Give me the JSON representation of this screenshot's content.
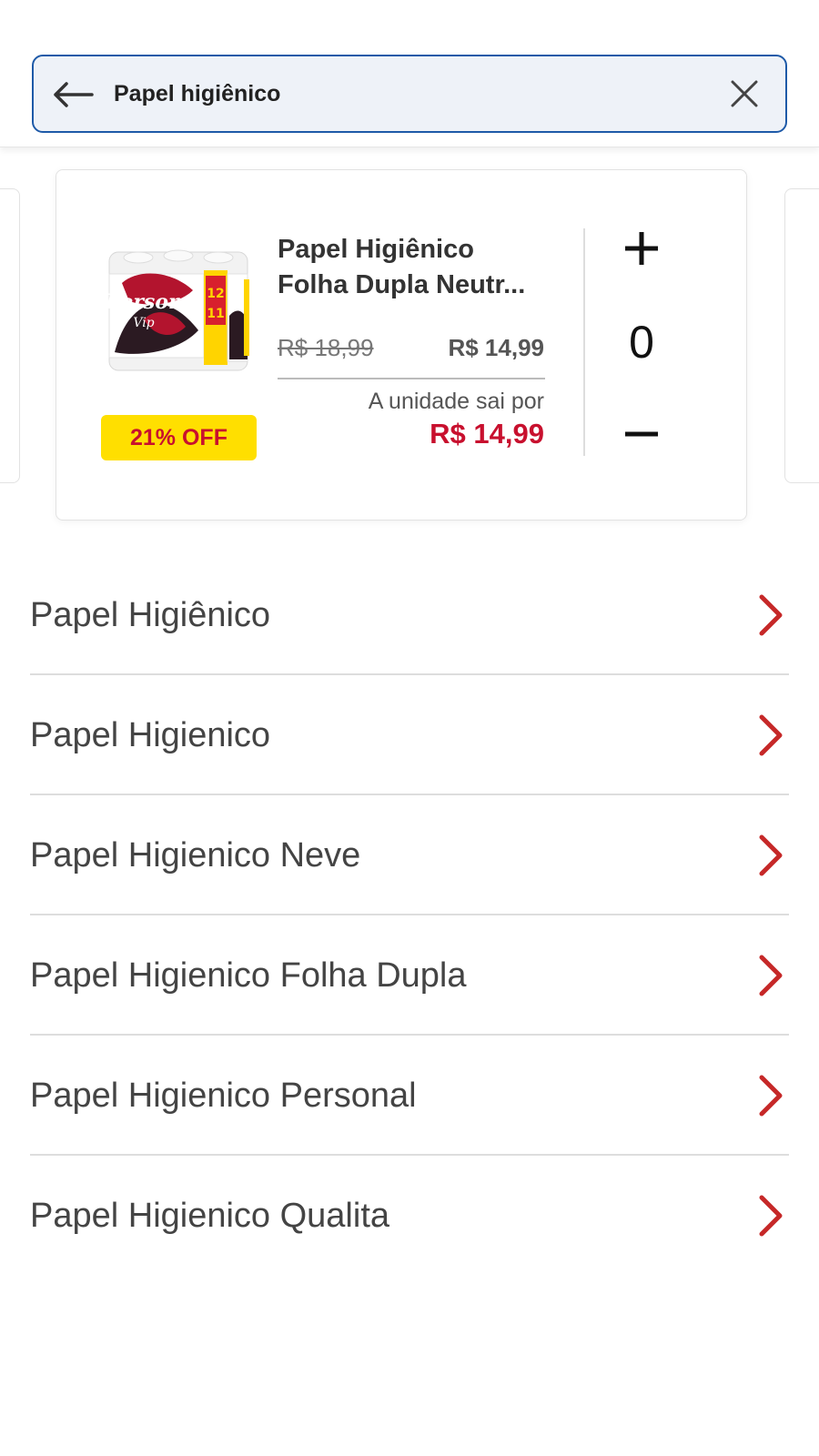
{
  "search": {
    "query": "Papel higiênico",
    "back_icon": "arrow-left-icon",
    "clear_icon": "close-icon"
  },
  "product": {
    "title": "Papel Higiênico Folha Dupla Neutr...",
    "image": "toilet-paper-package-image",
    "image_text": "Personal Vip",
    "discount_badge": "21% OFF",
    "old_price": "R$ 18,99",
    "current_price": "R$ 14,99",
    "unit_label": "A unidade sai por",
    "unit_price": "R$ 14,99",
    "quantity": "0",
    "plus_icon": "plus-icon",
    "minus_icon": "minus-icon"
  },
  "suggestions": [
    {
      "label": "Papel Higiênico"
    },
    {
      "label": "Papel Higienico"
    },
    {
      "label": "Papel Higienico Neve"
    },
    {
      "label": "Papel Higienico Folha Dupla"
    },
    {
      "label": "Papel Higienico Personal"
    },
    {
      "label": "Papel Higienico Qualita"
    }
  ],
  "colors": {
    "accent_blue": "#1e5aa8",
    "price_red": "#c8102e",
    "badge_yellow": "#ffdf00",
    "chevron_red": "#c62828"
  }
}
